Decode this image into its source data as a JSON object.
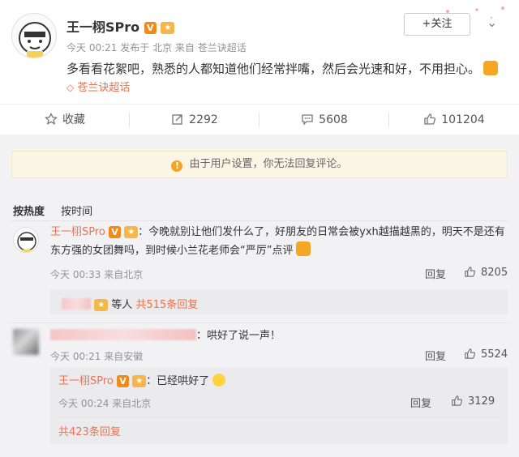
{
  "post": {
    "author": "王一栩SPro",
    "verified_mark": "V",
    "meta": {
      "time": "今天 00:21",
      "published_prefix": "发布于",
      "location": "北京",
      "source_prefix": "来自",
      "source": "苍兰诀超话"
    },
    "content": "多看看花絮吧，熟悉的人都知道他们经常拌嘴，然后会光速和好，不用担心。",
    "topic": "苍兰诀超话",
    "follow_label": "+关注"
  },
  "actions": {
    "favorite_label": "收藏",
    "repost_count": "2292",
    "comment_count": "5608",
    "like_count": "101204"
  },
  "notice": "由于用户设置，你无法回复评论。",
  "sort": {
    "hot": "按热度",
    "time": "按时间"
  },
  "comment1": {
    "author": "王一栩SPro",
    "text_line1": "：今晚就别让他们发什么了，好朋友的日常会被yxh越描越黑的，明天不是还有",
    "text_line2": "东方强的女团舞吗，到时候小兰花老师会“严厉”点评",
    "meta": "今天 00:33 来自北京",
    "reply_label": "回复",
    "likes": "8205",
    "replies_suffix": "等人",
    "replies_total": "共515条回复"
  },
  "comment2": {
    "text": "：哄好了说一声！",
    "meta": "今天 00:21 来自安徽",
    "reply_label": "回复",
    "likes": "5524",
    "sub": {
      "author": "王一栩SPro",
      "text": "：已经哄好了",
      "meta": "今天 00:24 来自北京",
      "reply_label": "回复",
      "likes": "3129"
    },
    "replies_total": "共423条回复"
  },
  "colors": {
    "accent": "#eb7350",
    "verified": "#f18a1a",
    "notice_bg": "#fbf5e6"
  },
  "icons": [
    "star-icon",
    "repost-icon",
    "comment-icon",
    "thumb-up-icon",
    "info-icon",
    "chevron-down-icon",
    "diamond-icon",
    "medal-icon",
    "laugh-emoji-icon"
  ]
}
